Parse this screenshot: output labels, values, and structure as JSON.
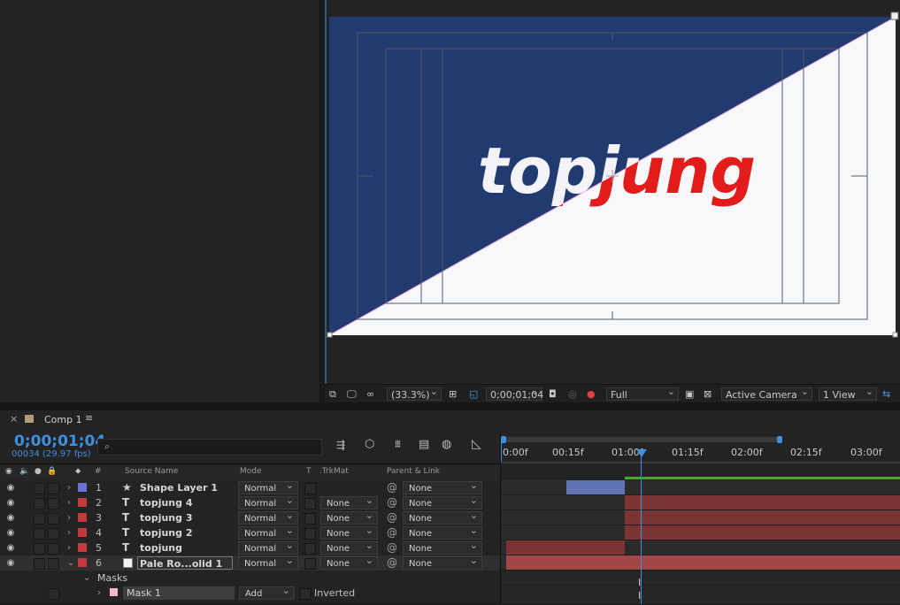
{
  "composition": {
    "canvas_brand_text": "topjung",
    "colors": {
      "navy": "#213b70",
      "white": "#f7f8fa",
      "accent_red": "#e21b1b",
      "cti": "#3d8fe0"
    }
  },
  "viewer_bar": {
    "zoom": "(33.3%)",
    "timecode": "0;00;01;04",
    "resolution": "Full",
    "camera": "Active Camera",
    "views": "1 View"
  },
  "timeline": {
    "tab_title": "Comp 1",
    "current_time": "0;00;01;04",
    "frame_info": "00034 (29.97 fps)",
    "search_placeholder": "",
    "columns": {
      "index": "#",
      "source_name": "Source Name",
      "mode": "Mode",
      "t": "T",
      "trkmat": ".TrkMat",
      "parent": "Parent & Link"
    },
    "ruler_labels": [
      "0:00f",
      "00:15f",
      "01:00f",
      "01:15f",
      "02:00f",
      "02:15f",
      "03:00f"
    ],
    "layers": [
      {
        "num": "1",
        "type": "★",
        "name": "Shape Layer 1",
        "mode": "Normal",
        "trkmat": "",
        "parent": "None",
        "label_color": "#6d6fd8",
        "bar_color": "#6073b3"
      },
      {
        "num": "2",
        "type": "T",
        "name": "topjung 4",
        "mode": "Normal",
        "trkmat": "None",
        "parent": "None",
        "label_color": "#c43a3a",
        "bar_color": "#7a3434"
      },
      {
        "num": "3",
        "type": "T",
        "name": "topjung 3",
        "mode": "Normal",
        "trkmat": "None",
        "parent": "None",
        "label_color": "#c43a3a",
        "bar_color": "#7a3434"
      },
      {
        "num": "4",
        "type": "T",
        "name": "topjung 2",
        "mode": "Normal",
        "trkmat": "None",
        "parent": "None",
        "label_color": "#c43a3a",
        "bar_color": "#7a3434"
      },
      {
        "num": "5",
        "type": "T",
        "name": "topjung",
        "mode": "Normal",
        "trkmat": "None",
        "parent": "None",
        "label_color": "#c43a3a",
        "bar_color": "#7a3434"
      },
      {
        "num": "6",
        "type": "",
        "name": "Pale Ro...olid 1",
        "mode": "Normal",
        "trkmat": "None",
        "parent": "None",
        "label_color": "#c43a3a",
        "bar_color": "#a04848"
      }
    ],
    "masks_label": "Masks",
    "mask": {
      "name": "Mask 1",
      "mode": "Add",
      "inverted_label": "Inverted",
      "color": "#f0b8c8"
    }
  }
}
